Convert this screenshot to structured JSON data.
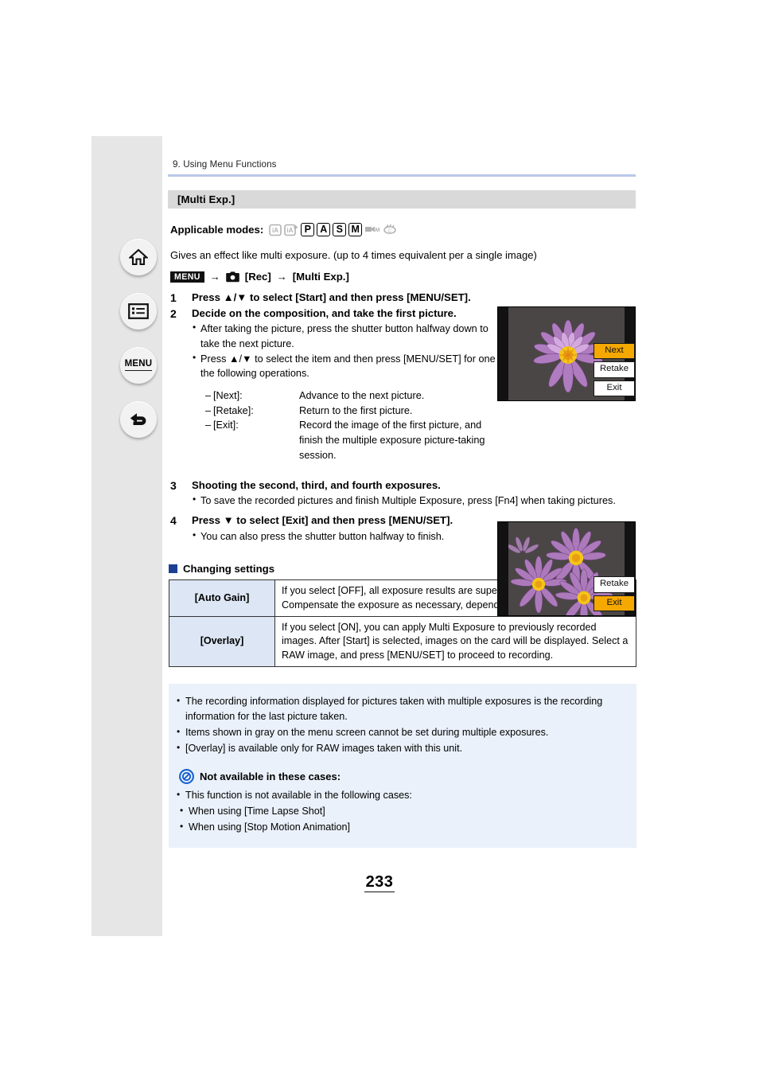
{
  "sidebar": {
    "buttons": [
      {
        "name": "home-icon",
        "label": ""
      },
      {
        "name": "contents-icon",
        "label": ""
      },
      {
        "name": "menu-icon",
        "label": "MENU"
      },
      {
        "name": "back-icon",
        "label": ""
      }
    ]
  },
  "page": {
    "chapter": "9. Using Menu Functions",
    "section_title": "[Multi Exp.]",
    "page_number": "233",
    "rule_color": "#b9c8e8",
    "section_bar_color": "#d9d9d9",
    "table_key_color": "#dce6f4",
    "note_box_color": "#eaf1fa",
    "highlight_color": "#f5a800"
  },
  "applicable": {
    "label": "Applicable modes:",
    "modes": [
      {
        "glyph": "iA",
        "active": false,
        "name": "mode-ia"
      },
      {
        "glyph": "iA+",
        "active": false,
        "name": "mode-ia-plus"
      },
      {
        "glyph": "P",
        "active": true,
        "name": "mode-p"
      },
      {
        "glyph": "A",
        "active": true,
        "name": "mode-a"
      },
      {
        "glyph": "S",
        "active": true,
        "name": "mode-s"
      },
      {
        "glyph": "M",
        "active": true,
        "name": "mode-m"
      },
      {
        "glyph": "M",
        "active": false,
        "name": "mode-creative-video"
      },
      {
        "glyph": "C",
        "active": false,
        "name": "mode-custom"
      }
    ]
  },
  "intro": "Gives an effect like multi exposure. (up to 4 times equivalent per a single image)",
  "menu_path": {
    "chip": "MENU",
    "arrow1": "→",
    "rec": "[Rec]",
    "arrow2": "→",
    "target": "[Multi Exp.]"
  },
  "steps": [
    {
      "num": "1",
      "title": "Press ▲/▼ to select [Start] and then press [MENU/SET].",
      "bullets": [],
      "defs": []
    },
    {
      "num": "2",
      "title": "Decide on the composition, and take the first picture.",
      "bullets": [
        "After taking the picture, press the shutter button halfway down to take the next picture.",
        "Press ▲/▼ to select the item and then press [MENU/SET] for one of the following operations."
      ],
      "defs": [
        {
          "term": "[Next]:",
          "desc": "Advance to the next picture."
        },
        {
          "term": "[Retake]:",
          "desc": "Return to the first picture."
        },
        {
          "term": "[Exit]:",
          "desc": "Record the image of the first picture, and finish the multiple exposure picture-taking session."
        }
      ]
    },
    {
      "num": "3",
      "title": "Shooting the second, third, and fourth exposures.",
      "bullets": [
        "To save the recorded pictures and finish Multiple Exposure, press [Fn4] when taking pictures."
      ],
      "defs": []
    },
    {
      "num": "4",
      "title": "Press ▼ to select [Exit] and then press [MENU/SET].",
      "bullets": [
        "You can also press the shutter button halfway to finish."
      ],
      "defs": []
    }
  ],
  "screenshots": [
    {
      "name": "camera-screen-first-picture",
      "buttons": [
        {
          "label": "Next",
          "selected": true
        },
        {
          "label": "Retake",
          "selected": false
        },
        {
          "label": "Exit",
          "selected": false
        }
      ]
    },
    {
      "name": "camera-screen-final-exposure",
      "buttons": [
        {
          "label": "Retake",
          "selected": false
        },
        {
          "label": "Exit",
          "selected": true
        }
      ]
    }
  ],
  "changing_settings": {
    "heading": "Changing settings",
    "rows": [
      {
        "key": "[Auto Gain]",
        "value": "If you select [OFF], all exposure results are superimposed as they are. Compensate the exposure as necessary, depending on the subject."
      },
      {
        "key": "[Overlay]",
        "value": "If you select [ON], you can apply Multi Exposure to previously recorded images. After [Start] is selected, images on the card will be displayed. Select a RAW image, and press [MENU/SET] to proceed to recording."
      }
    ]
  },
  "notes": {
    "items": [
      "The recording information displayed for pictures taken with multiple exposures is the recording information for the last picture taken.",
      "Items shown in gray on the menu screen cannot be set during multiple exposures.",
      "[Overlay] is available only for RAW images taken with this unit."
    ],
    "not_available_heading": "Not available in these cases:",
    "not_available_intro": "This function is not available in the following cases:",
    "not_available_cases": [
      "When using [Time Lapse Shot]",
      "When using [Stop Motion Animation]"
    ]
  }
}
